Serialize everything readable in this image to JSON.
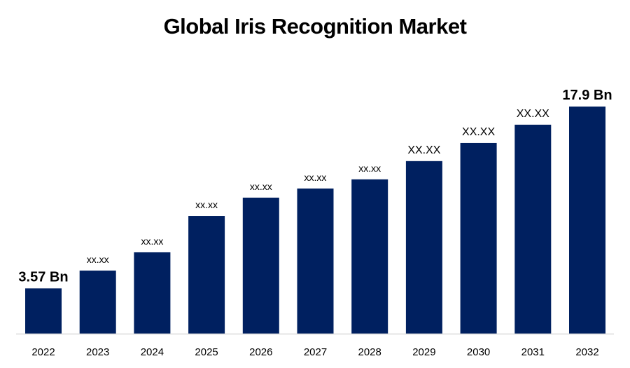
{
  "chart_data": {
    "type": "bar",
    "title": "Global Iris Recognition Market",
    "xlabel": "",
    "ylabel": "",
    "categories": [
      "2022",
      "2023",
      "2024",
      "2025",
      "2026",
      "2027",
      "2028",
      "2029",
      "2030",
      "2031",
      "2032"
    ],
    "values": [
      3.57,
      4.97,
      6.41,
      9.28,
      10.72,
      11.44,
      12.16,
      13.6,
      15.03,
      16.47,
      17.9
    ],
    "data_labels": [
      "3.57 Bn",
      "xx.xx",
      "xx.xx",
      "xx.xx",
      "xx.xx",
      "xx.xx",
      "xx.xx",
      "XX.XX",
      "XX.XX",
      "XX.XX",
      "17.9 Bn"
    ],
    "label_emphasis": [
      true,
      false,
      false,
      false,
      false,
      false,
      false,
      false,
      false,
      false,
      true
    ],
    "ylim": [
      0,
      17.9
    ],
    "grid": false,
    "legend": "none",
    "bar_color": "#002060",
    "axis_color": "#d9d9d9"
  }
}
